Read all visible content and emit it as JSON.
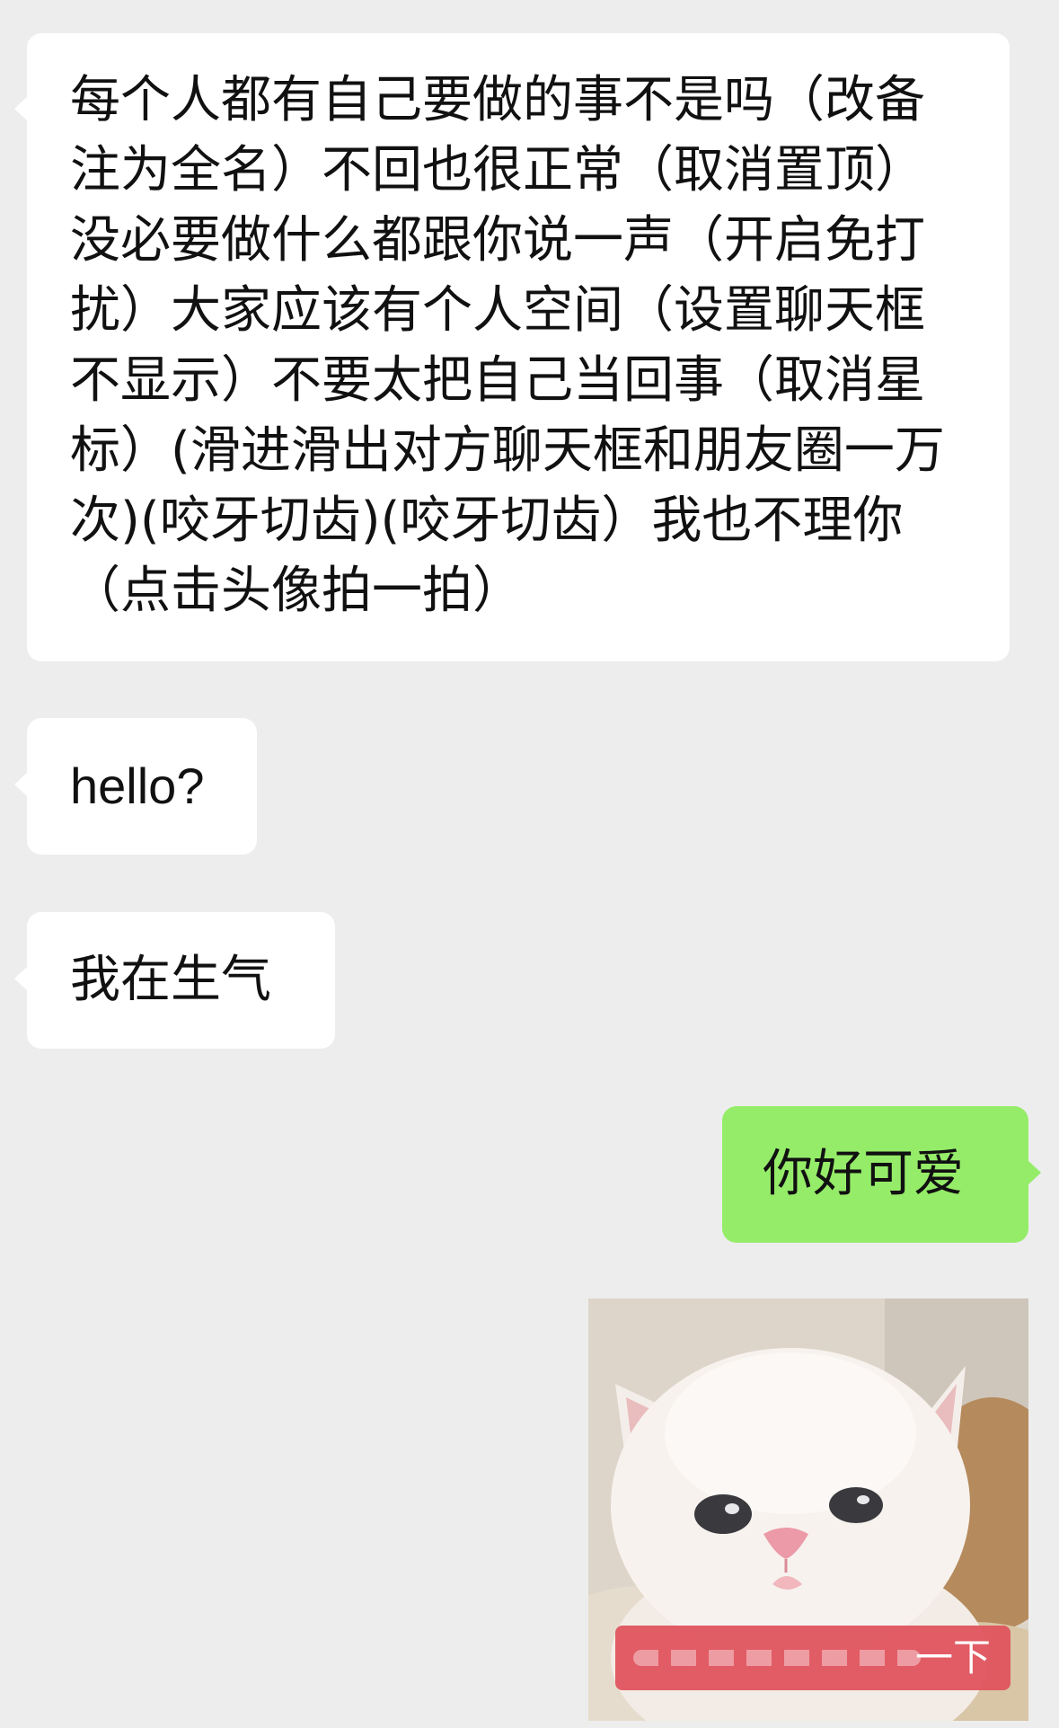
{
  "colors": {
    "chat_background": "#ededed",
    "received_bubble": "#ffffff",
    "sent_bubble": "#95ec69",
    "text": "#111111",
    "sticker_caption_bar": "#e0525c"
  },
  "messages": [
    {
      "direction": "received",
      "text": "每个人都有自己要做的事不是吗（改备注为全名）不回也很正常（取消置顶）没必要做什么都跟你说一声（开启免打扰）大家应该有个人空间（设置聊天框不显示）不要太把自己当回事（取消星标）(滑进滑出对方聊天框和朋友圈一万次)(咬牙切齿)(咬牙切齿）我也不理你（点击头像拍一拍）"
    },
    {
      "direction": "received",
      "text": "hello?"
    },
    {
      "direction": "received",
      "text": "我在生气"
    },
    {
      "direction": "sent",
      "text": "你好可爱"
    }
  ],
  "sticker": {
    "direction": "sent",
    "subject": "white kitten",
    "caption_visible": "一下"
  }
}
